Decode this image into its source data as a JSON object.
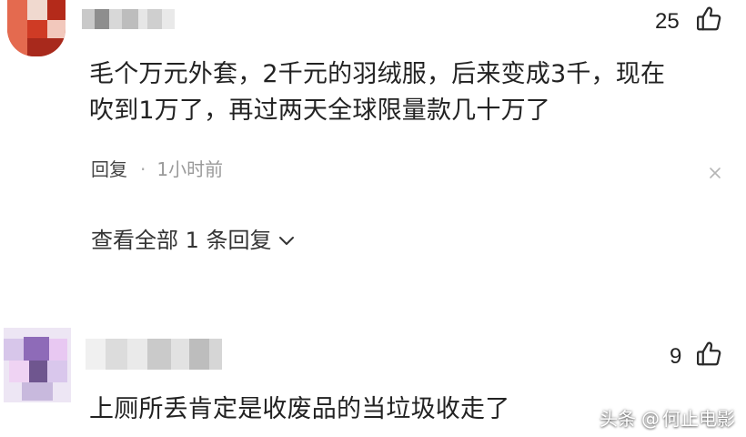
{
  "comments": [
    {
      "likes": "25",
      "text_line1": "毛个万元外套，2千元的羽绒服，后来变成3千，现在",
      "text_line2": "吹到1万了，再过两天全球限量款几十万了",
      "reply_label": "回复",
      "separator": "·",
      "time": "1小时前",
      "view_replies": "查看全部 1 条回复",
      "icons": {
        "like": "thumbs-up-icon",
        "close": "close-icon",
        "expand": "chevron-down-icon"
      }
    },
    {
      "likes": "9",
      "text_line1": "上厕所丢肯定是收废品的当垃圾收走了",
      "icons": {
        "like": "thumbs-up-icon"
      }
    }
  ],
  "watermark": {
    "source": "头条",
    "at": "@",
    "account": "何止电影"
  },
  "colors": {
    "text": "#222222",
    "meta": "#9a9a9a",
    "avatar1_main": "#c2321f",
    "avatar2_main": "#c9b6dc"
  }
}
